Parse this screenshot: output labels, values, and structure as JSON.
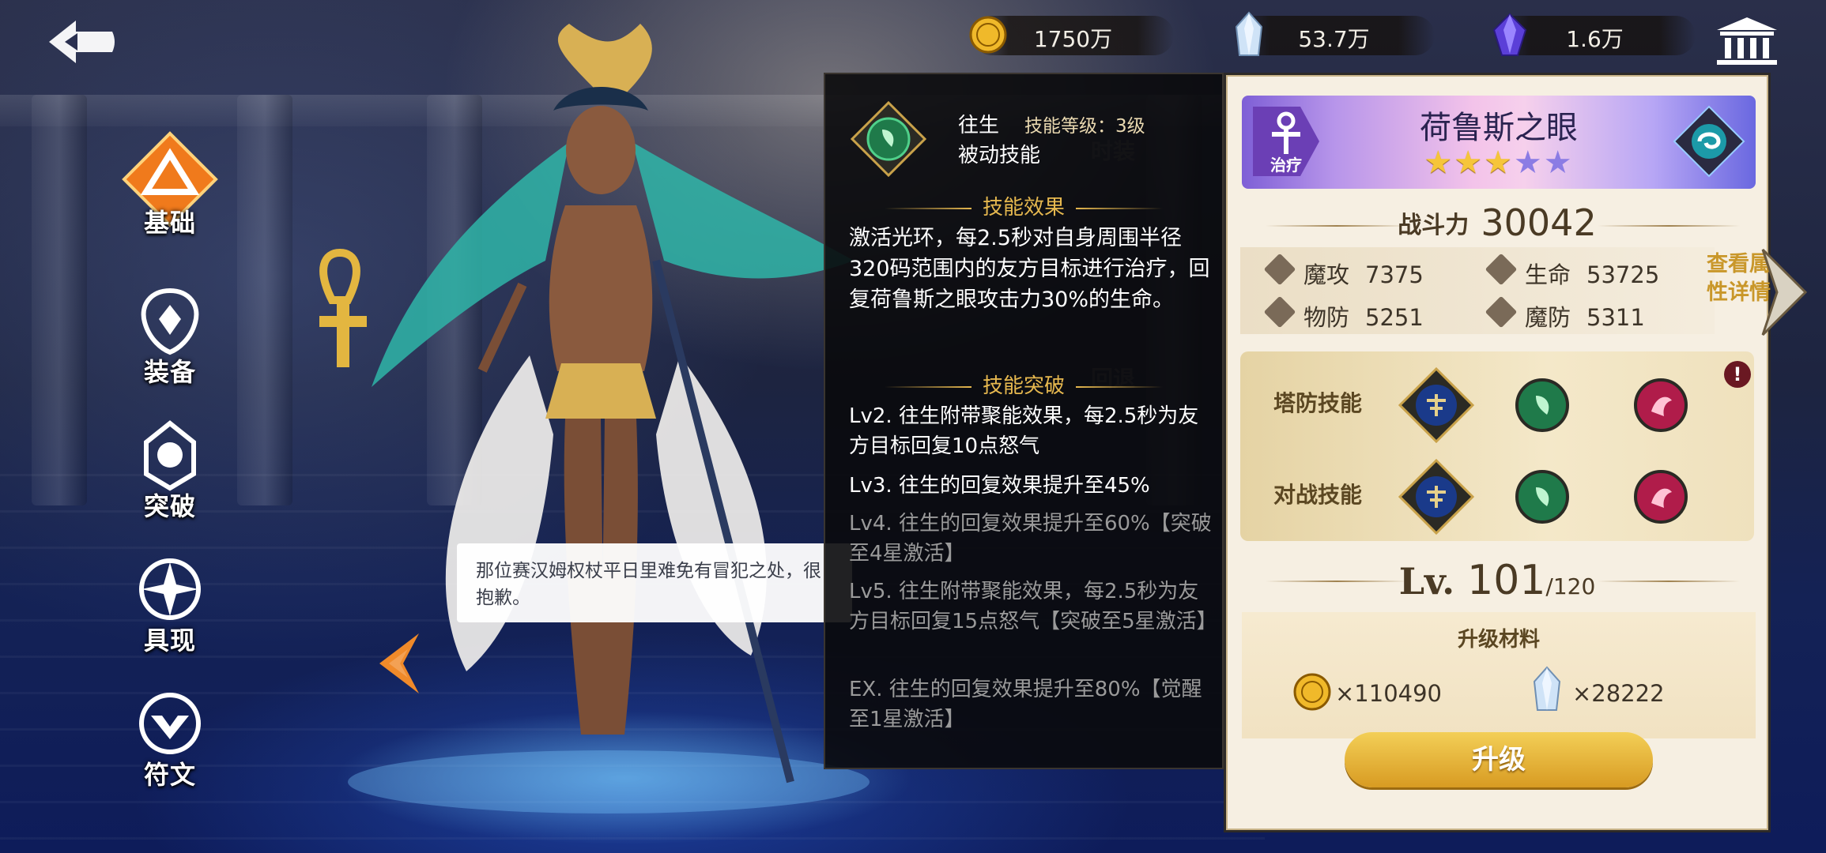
{
  "topbar": {
    "gold": "1750万",
    "crystal": "53.7万",
    "gem": "1.6万"
  },
  "nav": [
    {
      "label": "基础",
      "icon": "basic-icon",
      "active": true
    },
    {
      "label": "装备",
      "icon": "equipment-icon"
    },
    {
      "label": "突破",
      "icon": "breakthrough-icon"
    },
    {
      "label": "具现",
      "icon": "manifest-icon"
    },
    {
      "label": "符文",
      "icon": "rune-icon"
    }
  ],
  "dialogue": "那位赛汉姆权杖平日里难免有冒犯之处，很抱歉。",
  "background_tabs": {
    "costume": "时装",
    "rollback": "回退"
  },
  "skill_tooltip": {
    "name": "往生",
    "level_label": "技能等级：3级",
    "type": "被动技能",
    "effect_title": "技能效果",
    "effect_desc": "激活光环，每2.5秒对自身周围半径320码范围内的友方目标进行治疗，回复荷鲁斯之眼攻击力30%的生命。",
    "break_title": "技能突破",
    "breaks": [
      {
        "text": "Lv2. 往生附带聚能效果，每2.5秒为友方目标回复10点怒气",
        "unlocked": true
      },
      {
        "text": "Lv3. 往生的回复效果提升至45%",
        "unlocked": true
      },
      {
        "text": "Lv4. 往生的回复效果提升至60%【突破至4星激活】",
        "unlocked": false
      },
      {
        "text": "Lv5. 往生附带聚能效果，每2.5秒为友方目标回复15点怒气【突破至5星激活】",
        "unlocked": false
      },
      {
        "text": "EX. 往生的回复效果提升至80%【觉醒至1星激活】",
        "unlocked": false
      }
    ]
  },
  "hero": {
    "class_label": "治疗",
    "name": "荷鲁斯之眼",
    "stars_total": 5,
    "stars_filled": 3,
    "power_label": "战斗力",
    "power_value": "30042",
    "stats": [
      {
        "label": "魔攻",
        "value": "7375",
        "icon": "magic-attack-icon"
      },
      {
        "label": "生命",
        "value": "53725",
        "icon": "health-icon"
      },
      {
        "label": "物防",
        "value": "5251",
        "icon": "physical-defense-icon"
      },
      {
        "label": "魔防",
        "value": "5311",
        "icon": "magic-defense-icon"
      }
    ],
    "detail_link": "查看属性详情",
    "skill_rows": [
      {
        "label": "塔防技能"
      },
      {
        "label": "对战技能"
      }
    ],
    "level_prefix": "Lv.",
    "level": "101",
    "level_max": "/120",
    "materials_title": "升级材料",
    "materials": [
      {
        "icon": "gold-coin-icon",
        "amount": "×110490"
      },
      {
        "icon": "crystal-icon",
        "amount": "×28222"
      }
    ],
    "upgrade_label": "升级"
  },
  "colors": {
    "accent_gold": "#e6b84f",
    "button_gold": "#d89b22",
    "panel_bg": "#f6efe2"
  }
}
